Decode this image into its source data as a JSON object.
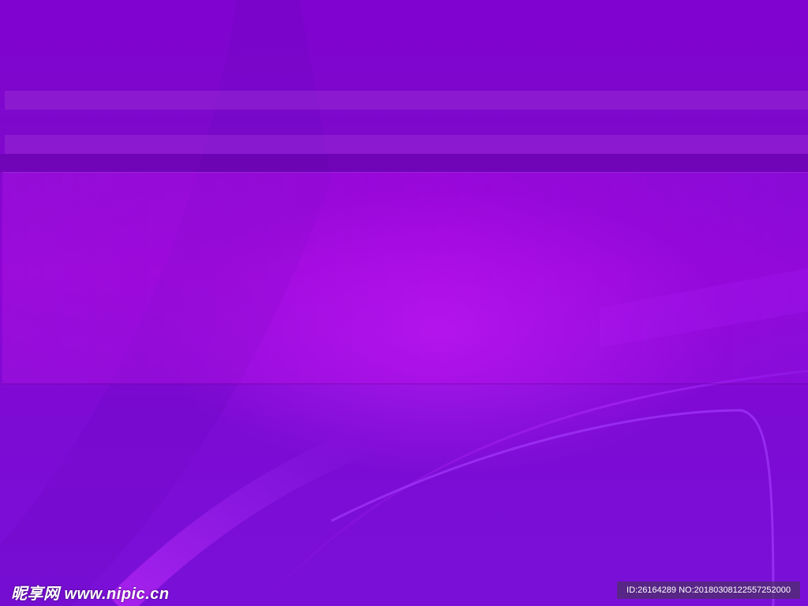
{
  "watermark": {
    "text": "昵享网 www.nipic.cn"
  },
  "image_id": {
    "text": "ID:26164289 NO:20180308122557252000"
  }
}
